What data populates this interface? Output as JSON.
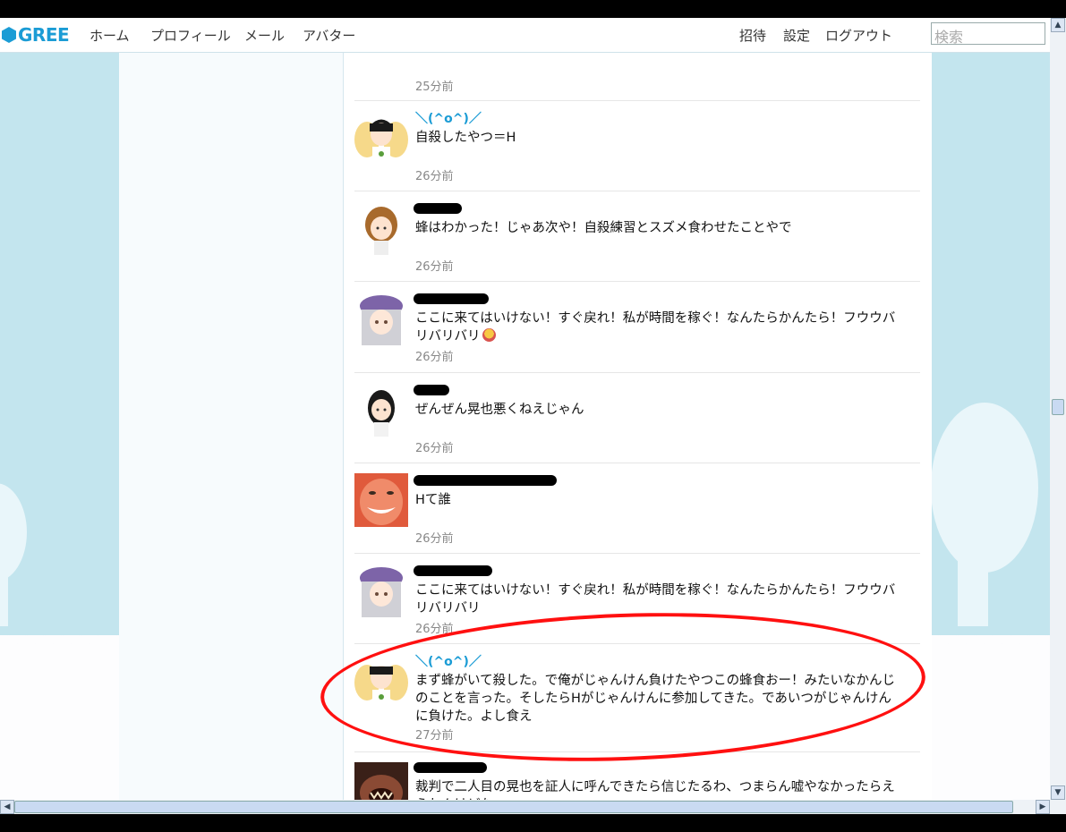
{
  "header": {
    "logo_text": "GREE",
    "nav": [
      "ホーム",
      "プロフィール",
      "メール",
      "アバター"
    ],
    "right_nav": [
      "招待",
      "設定",
      "ログアウト"
    ],
    "search_placeholder": "検索"
  },
  "colors": {
    "brand": "#1b9cd5",
    "background": "#c3e5ee",
    "highlight_circle": "#ff1010"
  },
  "posts": [
    {
      "name": "",
      "text": "",
      "time": "25分前",
      "avatar": "anime-girl-purple-hat-avatar"
    },
    {
      "name": "＼(^o^)／",
      "text": "自殺したやつ＝H",
      "time": "26分前",
      "avatar": "fairy-boy-avatar"
    },
    {
      "name": "",
      "text": "蜂はわかった！じゃあ次や！自殺練習とスズメ食わせたことやで",
      "time": "26分前",
      "avatar": "brown-hair-girl-avatar"
    },
    {
      "name": "",
      "text": "ここに来てはいけない！すぐ戻れ！私が時間を稼ぐ！なんたらかんたら！フウウバリバリバリ",
      "time": "26分前",
      "avatar": "anime-girl-purple-hat-avatar",
      "emoji": true
    },
    {
      "name": "",
      "text": "ぜんぜん晃也悪くねえじゃん",
      "time": "26分前",
      "avatar": "black-hair-girl-avatar"
    },
    {
      "name": "",
      "text": "Hて誰",
      "time": "26分前",
      "avatar": "smiling-face-photo-avatar"
    },
    {
      "name": "",
      "text": "ここに来てはいけない！すぐ戻れ！私が時間を稼ぐ！なんたらかんたら！フウウバリバリバリ",
      "time": "26分前",
      "avatar": "anime-girl-purple-hat-avatar"
    },
    {
      "name": "＼(^o^)／",
      "text": "まず蜂がいて殺した。で俺がじゃんけん負けたやつこの蜂食おー！みたいなかんじのことを言った。そしたらHがじゃんけんに参加してきた。であいつがじゃんけんに負けた。よし食え",
      "time": "27分前",
      "avatar": "fairy-boy-avatar"
    },
    {
      "name": "",
      "text": "裁判で二人目の晃也を証人に呼んできたら信じたるわ、つまらん嘘やなかったらええねんけどな",
      "time": "",
      "avatar": "monster-avatar"
    }
  ]
}
